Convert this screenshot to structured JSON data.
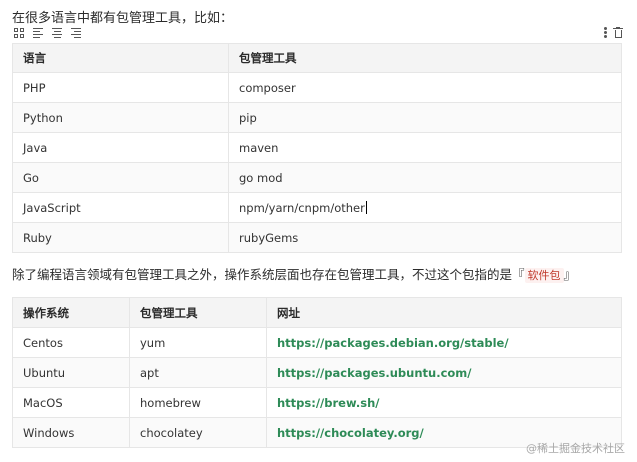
{
  "intro_text": "在很多语言中都有包管理工具，比如：",
  "table1": {
    "headers": [
      "语言",
      "包管理工具"
    ],
    "rows": [
      [
        "PHP",
        "composer"
      ],
      [
        "Python",
        "pip"
      ],
      [
        "Java",
        "maven"
      ],
      [
        "Go",
        "go mod"
      ],
      [
        "JavaScript",
        "npm/yarn/cnpm/other"
      ],
      [
        "Ruby",
        "rubyGems"
      ]
    ]
  },
  "paragraph": {
    "before": "除了编程语言领域有包管理工具之外，操作系统层面也存在包管理工具，不过这个包指的是『",
    "tag": "软件包",
    "after": "』"
  },
  "table2": {
    "headers": [
      "操作系统",
      "包管理工具",
      "网址"
    ],
    "rows": [
      [
        "Centos",
        "yum",
        "https://packages.debian.org/stable/"
      ],
      [
        "Ubuntu",
        "apt",
        "https://packages.ubuntu.com/"
      ],
      [
        "MacOS",
        "homebrew",
        "https://brew.sh/"
      ],
      [
        "Windows",
        "chocolatey",
        "https://chocolatey.org/"
      ]
    ]
  },
  "watermark": "@稀土掘金技术社区",
  "icons": [
    "table-grid-icon",
    "align-left-icon",
    "align-center-icon",
    "align-right-icon",
    "more-options-icon",
    "trash-icon"
  ],
  "colors": {
    "link": "#2e8b57",
    "tag": "#c0392b",
    "header_bg": "#f4f4f4"
  }
}
